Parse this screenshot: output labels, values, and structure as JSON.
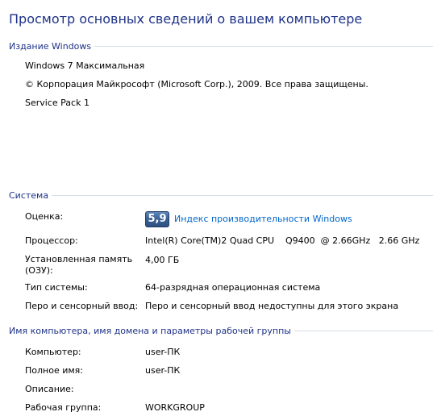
{
  "page_title": "Просмотр основных сведений о вашем компьютере",
  "edition": {
    "header": "Издание Windows",
    "name": "Windows 7 Максимальная",
    "copyright": "© Корпорация Майкрософт (Microsoft Corp.), 2009. Все права защищены.",
    "service_pack": "Service Pack 1"
  },
  "system": {
    "header": "Система",
    "rating_label": "Оценка:",
    "rating_score": "5,9",
    "rating_link": "Индекс производительности Windows",
    "processor_label": "Процессор:",
    "processor_value": "Intel(R) Core(TM)2 Quad CPU    Q9400  @ 2.66GHz   2.66 GHz",
    "memory_label_line1": "Установленная память",
    "memory_label_line2": "(ОЗУ):",
    "memory_value": "4,00 ГБ",
    "type_label": "Тип системы:",
    "type_value": "64-разрядная операционная система",
    "pen_label": "Перо и сенсорный ввод:",
    "pen_value": "Перо и сенсорный ввод недоступны для этого экрана"
  },
  "computer": {
    "header": "Имя компьютера, имя домена и параметры рабочей группы",
    "computer_label": "Компьютер:",
    "computer_value": "user-ПК",
    "fullname_label": "Полное имя:",
    "fullname_value": "user-ПК",
    "description_label": "Описание:",
    "description_value": "",
    "workgroup_label": "Рабочая группа:",
    "workgroup_value": "WORKGROUP"
  },
  "colors": {
    "heading": "#1e3287",
    "link": "#0066cc",
    "badge": "#3d6396"
  }
}
